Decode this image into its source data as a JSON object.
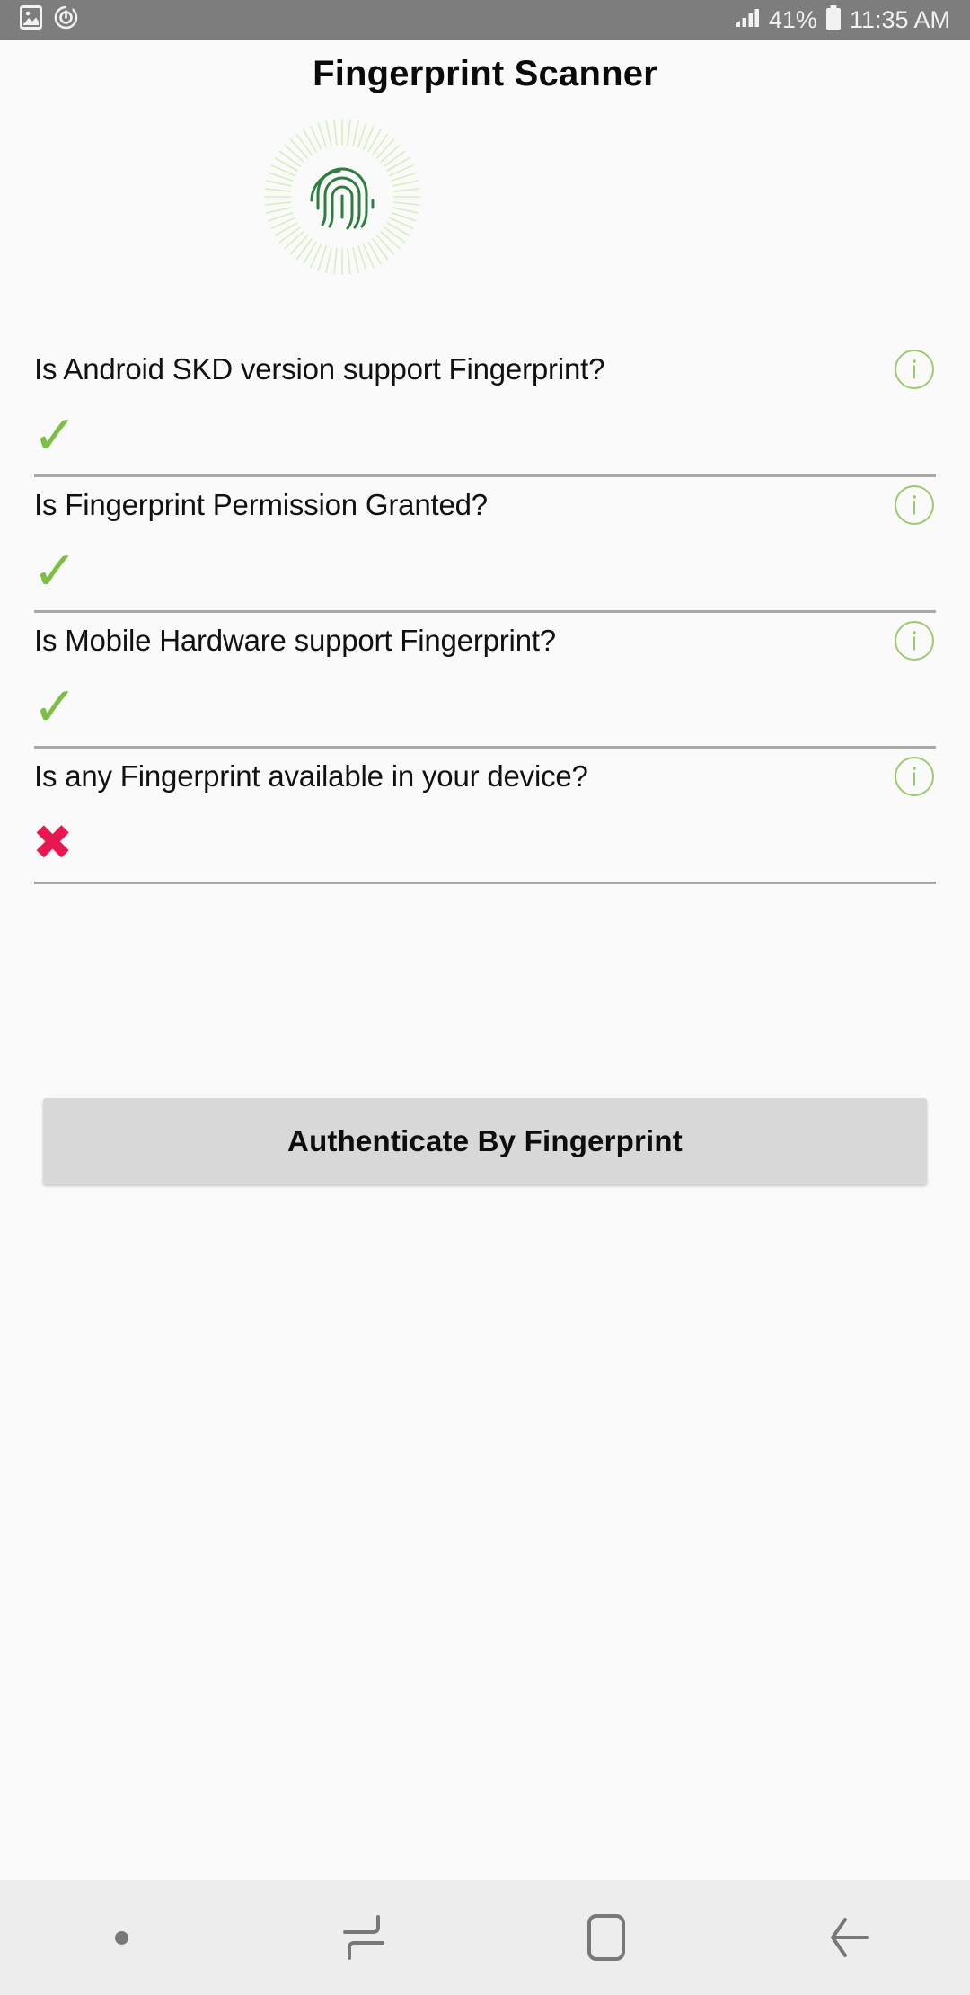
{
  "status_bar": {
    "background_color": "#7d7d7d",
    "left_icons": [
      {
        "name": "screenshot-image-icon"
      },
      {
        "name": "alarm-power-icon"
      }
    ],
    "signal_icon": "signal-bars-icon",
    "battery_percent": "41%",
    "battery_icon": "battery-icon",
    "time": "11:35 AM"
  },
  "header": {
    "title": "Fingerprint Scanner"
  },
  "hero": {
    "icon_name": "fingerprint-scan-icon",
    "ring_color": "#d9f0c6",
    "print_color": "#2f7d3f"
  },
  "questions": [
    {
      "label": "Is Android SKD version support Fingerprint?",
      "info_icon": "info-icon",
      "result": "✓",
      "result_state": "pass",
      "result_color": "#7cc043"
    },
    {
      "label": "Is Fingerprint Permission Granted?",
      "info_icon": "info-icon",
      "result": "✓",
      "result_state": "pass",
      "result_color": "#7cc043"
    },
    {
      "label": "Is Mobile Hardware support Fingerprint?",
      "info_icon": "info-icon",
      "result": "✓",
      "result_state": "pass",
      "result_color": "#7cc043"
    },
    {
      "label": "Is any Fingerprint available in your device?",
      "info_icon": "info-icon",
      "result": "✖",
      "result_state": "fail",
      "result_color": "#e8174f"
    }
  ],
  "action": {
    "authenticate_label": "Authenticate By Fingerprint",
    "background_color": "#d8d8d8"
  },
  "nav_bar": {
    "background_color": "#ededed",
    "items": [
      {
        "name": "keyboard-dot-indicator"
      },
      {
        "name": "recent-apps-icon"
      },
      {
        "name": "home-icon"
      },
      {
        "name": "back-icon"
      }
    ]
  }
}
